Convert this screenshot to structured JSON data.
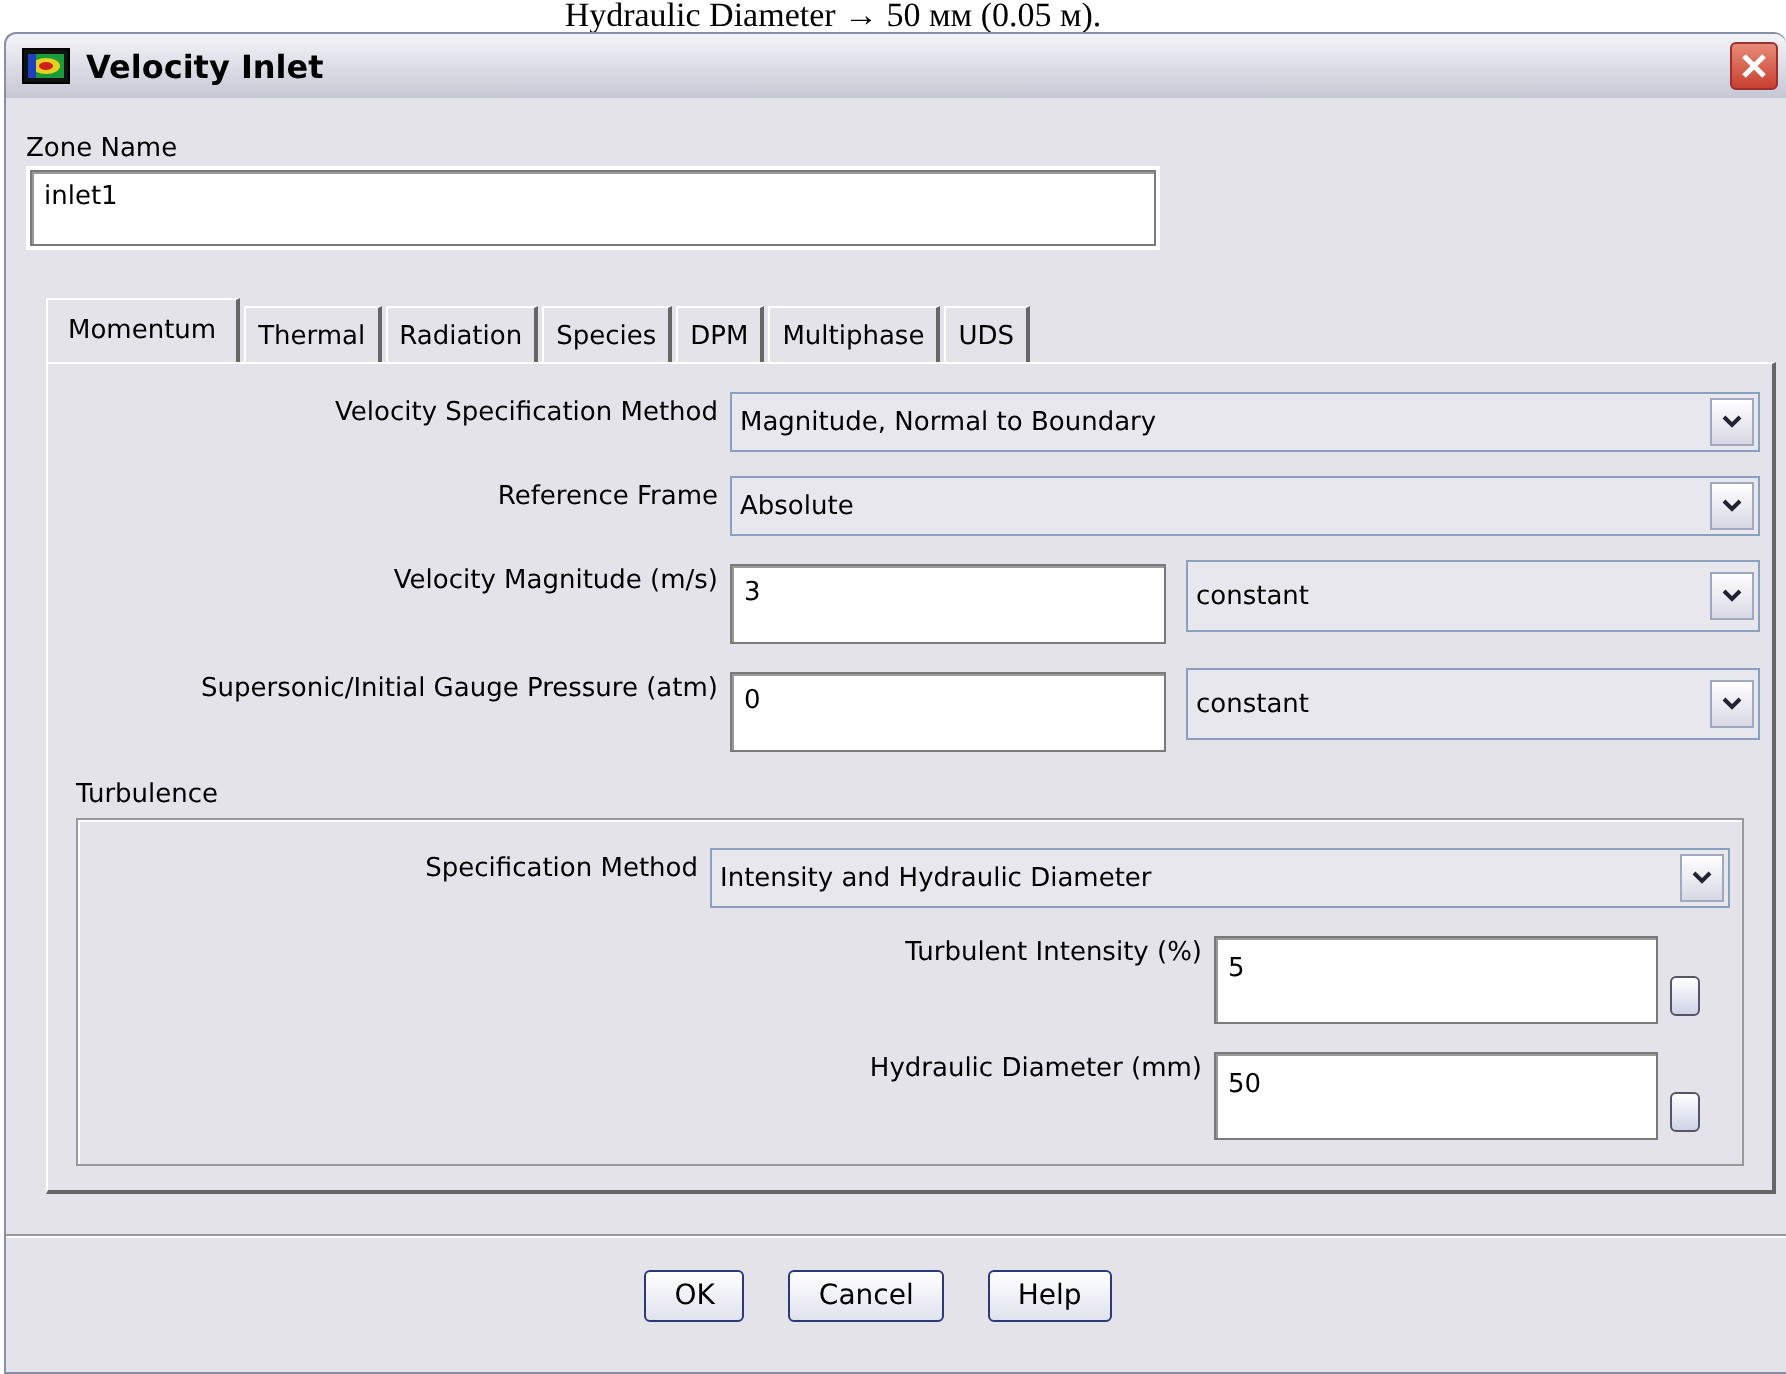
{
  "caption": "Hydraulic Diameter → 50 мм (0.05 м).",
  "window": {
    "title": "Velocity Inlet"
  },
  "zone_name": {
    "label": "Zone Name",
    "value": "inlet1"
  },
  "tabs": [
    {
      "label": "Momentum",
      "selected": true
    },
    {
      "label": "Thermal",
      "selected": false
    },
    {
      "label": "Radiation",
      "selected": false
    },
    {
      "label": "Species",
      "selected": false
    },
    {
      "label": "DPM",
      "selected": false
    },
    {
      "label": "Multiphase",
      "selected": false
    },
    {
      "label": "UDS",
      "selected": false
    }
  ],
  "momentum": [
    {
      "kind": "select",
      "label": "Velocity Specification Method",
      "value": "Magnitude, Normal to Boundary"
    },
    {
      "kind": "select",
      "label": "Reference Frame",
      "value": "Absolute"
    },
    {
      "kind": "input",
      "label": "Velocity Magnitude (m/s)",
      "value": "3",
      "method": "constant"
    },
    {
      "kind": "input",
      "label": "Supersonic/Initial Gauge Pressure (atm)",
      "value": "0",
      "method": "constant"
    }
  ],
  "turbulence": {
    "title": "Turbulence",
    "specification": {
      "label": "Specification Method",
      "value": "Intensity and Hydraulic Diameter"
    },
    "fields": [
      {
        "label": "Turbulent Intensity (%)",
        "value": "5",
        "toggle_checked": false
      },
      {
        "label": "Hydraulic Diameter (mm)",
        "value": "50",
        "toggle_checked": false
      }
    ]
  },
  "buttons": [
    "OK",
    "Cancel",
    "Help"
  ]
}
